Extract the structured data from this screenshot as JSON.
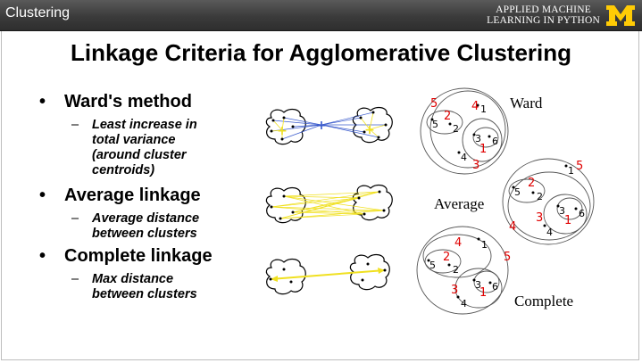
{
  "header": {
    "section": "Clustering",
    "course_line1": "APPLIED MACHINE",
    "course_line2": "LEARNING IN PYTHON",
    "logo_letter": "M",
    "logo_color": "#ffcb05"
  },
  "slide": {
    "title": "Linkage Criteria for Agglomerative Clustering",
    "bullets": [
      {
        "label": "Ward's method",
        "sub": "Least increase in total variance (around cluster centroids)"
      },
      {
        "label": "Average linkage",
        "sub": "Average distance between clusters"
      },
      {
        "label": "Complete linkage",
        "sub": "Max distance between clusters"
      }
    ],
    "bullet_symbol": "•",
    "dash_symbol": "–",
    "diagram_labels": {
      "ward": "Ward",
      "average": "Average",
      "complete": "Complete"
    },
    "accent_red": "#e00000",
    "link_blue": "#3a5bcc",
    "link_yellow": "#f0e020"
  },
  "ward_diagram": {
    "points": [
      "1",
      "2",
      "3",
      "4",
      "5",
      "6"
    ],
    "merge_order": [
      "5",
      "4",
      "2",
      "1",
      "3"
    ]
  },
  "average_diagram": {
    "points": [
      "1",
      "2",
      "3",
      "4",
      "5",
      "6"
    ],
    "merge_order": [
      "5",
      "2",
      "4",
      "3",
      "1"
    ]
  },
  "complete_diagram": {
    "points": [
      "1",
      "2",
      "3",
      "4",
      "5",
      "6"
    ],
    "merge_order": [
      "4",
      "5",
      "2",
      "3",
      "1"
    ]
  }
}
